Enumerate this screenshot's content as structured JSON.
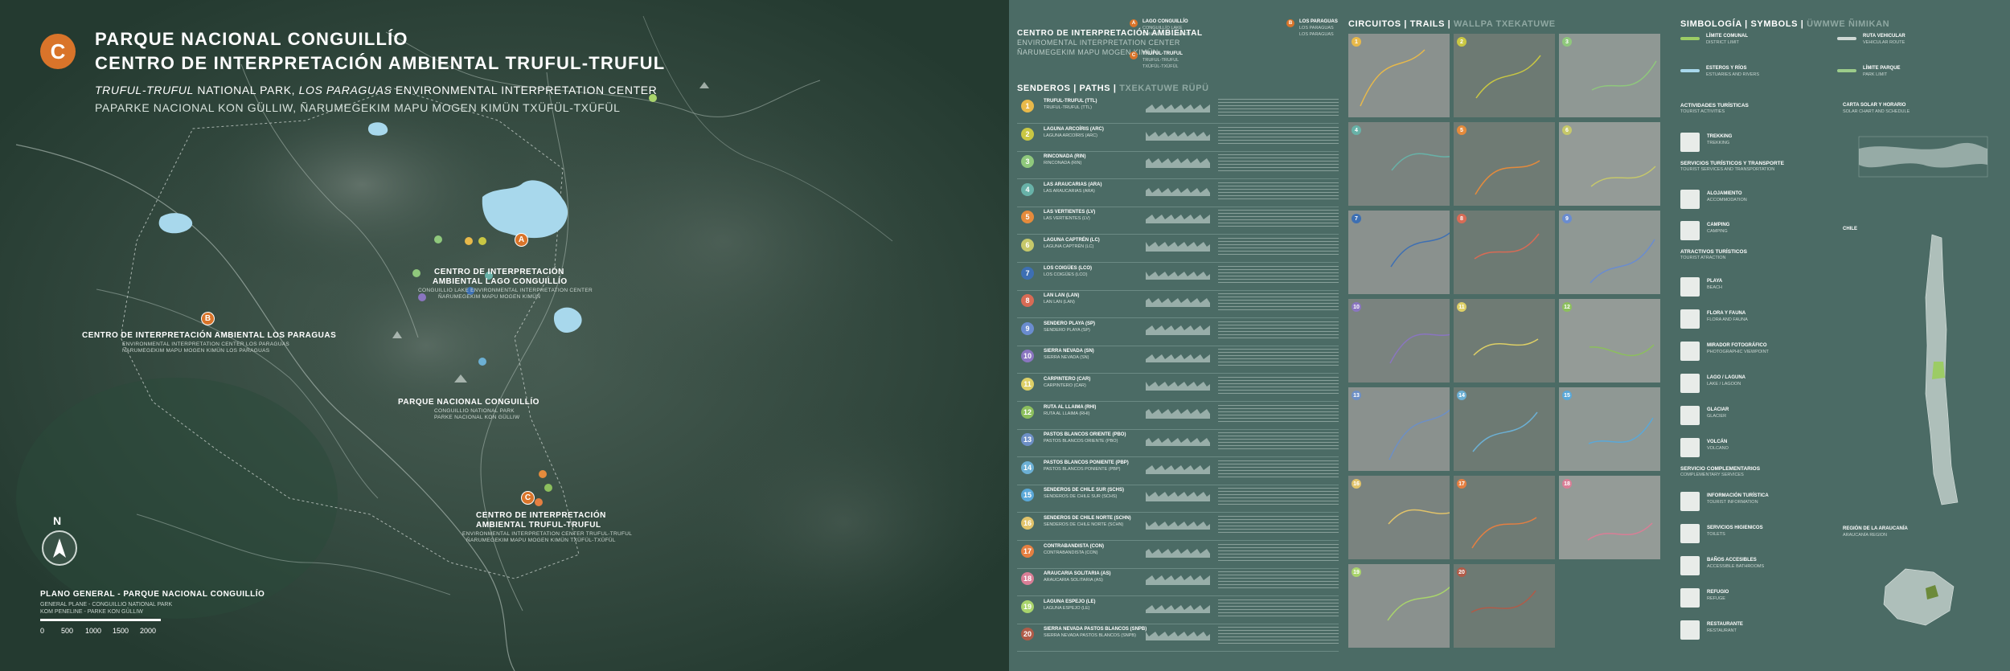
{
  "colors": {
    "accent": "#d9742a",
    "panel": "#4b6b65",
    "map_bg": "#20352d",
    "water": "#a8d8ec",
    "trail_nums": [
      "#e8b94a",
      "#c9c743",
      "#8fc87c",
      "#68b2a8",
      "#e58b3c",
      "#c6c86a",
      "#3d6fb3",
      "#d86b55",
      "#6a8ccf",
      "#8a75c0",
      "#ddcf66",
      "#8cbf5d",
      "#6d8fc5",
      "#6cb0d4",
      "#5aa8d8",
      "#e1c36a",
      "#e57f41",
      "#d97e96",
      "#a9d46c",
      "#b05b48"
    ]
  },
  "header": {
    "badge": "C",
    "title1": "PARQUE NACIONAL CONGUILLÍO",
    "title2": "CENTRO DE INTERPRETACIÓN AMBIENTAL TRUFUL-TRUFUL",
    "title3_italic": "TRUFUL-TRUFUL",
    "title3_rest": " NATIONAL PARK, ",
    "title3_italic2": "LOS PARAGUAS",
    "title3_rest2": " ENVIRONMENTAL INTERPRETATION CENTER",
    "title4": "PAPARKE NACIONAL KON GÜLLIW, ÑARUMEGEKIM MAPU MOGEN  KIMÜN TXÜFÜL-TXÜFÜL"
  },
  "map": {
    "labels": [
      {
        "id": "conguillio",
        "title1": "CENTRO DE INTERPRETACIÓN",
        "title2": "AMBIENTAL LAGO CONGUILLÍO",
        "sub1": "CONGUILLIO LAKE ENVIRONMENTAL INTERPRETATION CENTER",
        "sub2": "ÑARUMEGEKIM MAPU MOGEN KIMÜN"
      },
      {
        "id": "paraguas",
        "title1": "CENTRO DE INTERPRETACIÓN AMBIENTAL LOS PARAGUAS",
        "sub1": "ENVIRONMENTAL INTERPRETATION CENTER LOS PARAGUAS",
        "sub2": "ÑARUMEGEKIM MAPU MOGEN KIMÜN LOS PARAGUAS"
      },
      {
        "id": "parque",
        "title1": "PARQUE NACIONAL CONGUILLÍO",
        "sub1": "CONGUILLIO NATIONAL PARK",
        "sub2": "PARKE NACIONAL KON GÜLLIW"
      },
      {
        "id": "truful",
        "title1": "CENTRO DE INTERPRETACIÓN",
        "title2": "AMBIENTAL TRUFUL-TRUFUL",
        "sub1": "ENVIRONMENTAL INTERPRETATION CENTER TRUFUL-TRUFUL",
        "sub2": "ÑARUMEGEKIM MAPU MOGEN KIMÜN TXÜFÜL-TXÜFÜL"
      }
    ],
    "pins": [
      "A",
      "B",
      "C"
    ],
    "north": "N",
    "plan_title": "PLANO GENERAL - PARQUE NACIONAL CONGUILLÍO",
    "plan_sub1": "GENERAL PLANE - CONGUILLIO NATIONAL PARK",
    "plan_sub2": "KOM PENELINE - PARKE KON GÜLLIW",
    "scale": [
      "0",
      "500",
      "1000",
      "1500",
      "2000"
    ]
  },
  "right": {
    "centers_title": "CENTRO DE INTERPRETACIÓN AMBIENTAL",
    "centers_sub1": "ENVIROMENTAL INTERPRETATION CENTER",
    "centers_sub2": "ÑARUMEGEKIM MAPU MOGEN KIMÜN",
    "center_list": [
      {
        "pin": "A",
        "l1": "LAGO CONGUILLÍO",
        "l2": "CONGUILLÍO LAKE",
        "l3": "KON GÜLLIW LAWKEN"
      },
      {
        "pin": "B",
        "l1": "LOS PARAGUAS",
        "l2": "LOS PARAGUAS",
        "l3": "LOS PARAGUAS"
      },
      {
        "pin": "C",
        "l1": "TRUFUL-TRUFUL",
        "l2": "TRUFUL-TRUFUL",
        "l3": "TXÜFÜL-TXÜFÜL"
      }
    ],
    "senderos_title": "SENDEROS",
    "senderos_sub": "PATHS",
    "senderos_sub2": "TXEKATUWE RÜPÜ",
    "trails": [
      {
        "n": "1",
        "name": "TRUFUL-TRUFUL (TTL)"
      },
      {
        "n": "2",
        "name": "LAGUNA ARCOÍRIS (ARC)"
      },
      {
        "n": "3",
        "name": "RINCONADA (RIN)"
      },
      {
        "n": "4",
        "name": "LAS ARAUCARIAS (ARA)"
      },
      {
        "n": "5",
        "name": "LAS VERTIENTES (LV)"
      },
      {
        "n": "6",
        "name": "LAGUNA CAPTRÉN (LC)"
      },
      {
        "n": "7",
        "name": "LOS COIGÜES (LCO)"
      },
      {
        "n": "8",
        "name": "LAN LAN (LAN)"
      },
      {
        "n": "9",
        "name": "SENDERO PLAYA (SP)"
      },
      {
        "n": "10",
        "name": "SIERRA NEVADA (SN)"
      },
      {
        "n": "11",
        "name": "CARPINTERO (CAR)"
      },
      {
        "n": "12",
        "name": "RUTA AL LLAIMA (RHI)"
      },
      {
        "n": "13",
        "name": "PASTOS BLANCOS ORIENTE (PBO)"
      },
      {
        "n": "14",
        "name": "PASTOS BLANCOS PONIENTE (PBP)"
      },
      {
        "n": "15",
        "name": "SENDEROS DE CHILE SUR (SCHS)"
      },
      {
        "n": "16",
        "name": "SENDEROS DE CHILE NORTE (SCHN)"
      },
      {
        "n": "17",
        "name": "CONTRABANDISTA (CON)"
      },
      {
        "n": "18",
        "name": "ARAUCARIA SOLITARIA (AS)"
      },
      {
        "n": "19",
        "name": "LAGUNA ESPEJO (LE)"
      },
      {
        "n": "20",
        "name": "SIERRA NEVADA PASTOS BLANCOS (SNPB)"
      }
    ],
    "circuitos_title": "CIRCUITOS",
    "circuitos_sub": "TRAILS",
    "circuitos_sub2": "WALLPA TXEKATUWE",
    "simbologia_title": "SIMBOLOGÍA",
    "simbologia_sub": "SYMBOLS",
    "simbologia_sub2": "ÜWMWE ÑIMIKAN",
    "legend_lines": [
      {
        "l1": "LÍMITE COMUNAL",
        "l2": "DISTRICT LIMIT",
        "color": "#9ccc65"
      },
      {
        "l1": "RUTA VEHICULAR",
        "l2": "VEHICULAR ROUTE",
        "color": "#cfd8d4"
      },
      {
        "l1": "ESTEROS Y RÍOS",
        "l2": "ESTUARIES AND RIVERS",
        "color": "#a8d8ec"
      },
      {
        "l1": "LÍMITE PARQUE",
        "l2": "PARK LIMIT",
        "color": "#9ccc8a"
      }
    ],
    "symbol_groups": [
      {
        "h1": "ACTIVIDADES TURÍSTICAS",
        "h2": "TOURIST ACTIVITIES"
      },
      {
        "h1": "SERVICIOS TURÍSTICOS Y TRANSPORTE",
        "h2": "TOURIST SERVICES AND TRANSPORTATION"
      },
      {
        "h1": "ATRACTIVOS TURÍSTICOS",
        "h2": "TOURIST ATRACTION"
      },
      {
        "h1": "SERVICIO COMPLEMENTARIOS",
        "h2": "COMPLEMENTARY SERVICES"
      }
    ],
    "symbols": [
      {
        "l1": "TREKKING",
        "l2": "TREKKING"
      },
      {
        "l1": "ALOJAMIENTO",
        "l2": "ACCOMMODATION"
      },
      {
        "l1": "CAMPING",
        "l2": "CAMPING"
      },
      {
        "l1": "PLAYA",
        "l2": "BEACH"
      },
      {
        "l1": "FLORA Y FAUNA",
        "l2": "FLORA AND FAUNA"
      },
      {
        "l1": "MIRADOR FOTOGRÁFICO",
        "l2": "PHOTOGRAPHIC VIEWPOINT"
      },
      {
        "l1": "LAGO / LAGUNA",
        "l2": "LAKE / LAGOON"
      },
      {
        "l1": "GLACIAR",
        "l2": "GLACIER"
      },
      {
        "l1": "VOLCÁN",
        "l2": "VOLCANO"
      },
      {
        "l1": "INFORMACIÓN TURÍSTICA",
        "l2": "TOURIST INFORMATION"
      },
      {
        "l1": "SERVICIOS HIGIENICOS",
        "l2": "TOILETS"
      },
      {
        "l1": "BAÑOS ACCESIBLES",
        "l2": "ACCESSIBLE BATHROOMS"
      },
      {
        "l1": "REFUGIO",
        "l2": "REFUGE"
      },
      {
        "l1": "RESTAURANTE",
        "l2": "RESTAURANT"
      }
    ],
    "solar_title": "CARTA SOLAR Y HORARIO",
    "solar_sub": "SOLAR CHART AND  SCHEDULE",
    "chile_label": "CHILE",
    "region_title": "REGIÓN DE LA ARAUCANÍA",
    "region_sub": "ARAUCANÍA REGION"
  }
}
